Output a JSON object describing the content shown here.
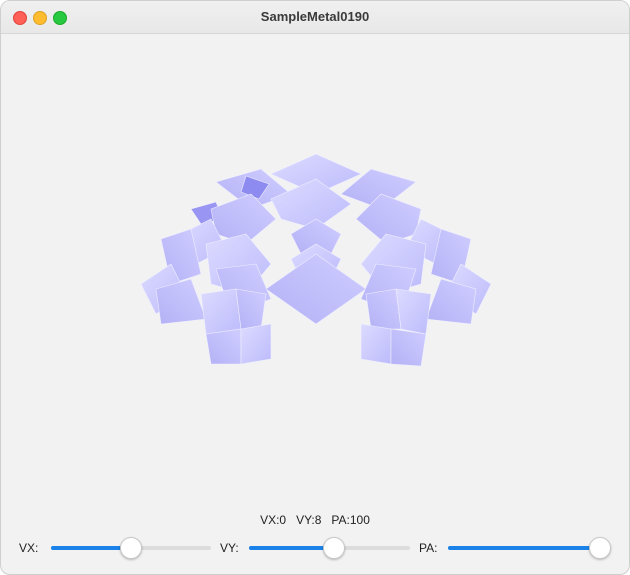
{
  "window": {
    "title": "SampleMetal0190"
  },
  "status": {
    "text": "VX:0   VY:8   PA:100"
  },
  "sliders": [
    {
      "label": "VX:",
      "value": 0,
      "fraction": 0.5
    },
    {
      "label": "VY:",
      "value": 8,
      "fraction": 0.525
    },
    {
      "label": "PA:",
      "value": 100,
      "fraction": 1.0
    }
  ],
  "colors": {
    "accent": "#1a82e8",
    "petal": "#c9c8ff",
    "petal_dark": "#8f8cf0",
    "background": "#f2f2f3"
  }
}
